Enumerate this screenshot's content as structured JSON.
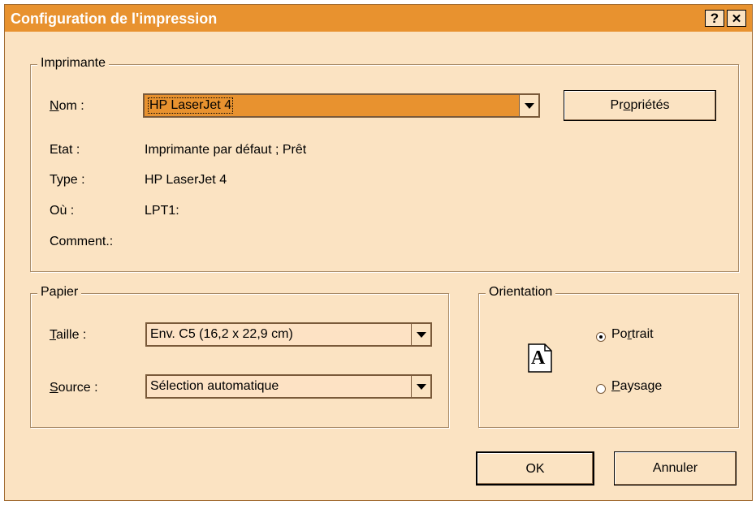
{
  "dialog": {
    "title": "Configuration de l'impression",
    "help_label": "?",
    "close_label": "✕"
  },
  "printer": {
    "legend": "Imprimante",
    "name_label_u": "N",
    "name_label_rest": "om :",
    "name_value": "HP LaserJet 4",
    "properties_pre": "Pr",
    "properties_u": "o",
    "properties_post": "priétés",
    "state_label": "Etat :",
    "state_value": "Imprimante par défaut ; Prêt",
    "type_label": "Type :",
    "type_value": "HP LaserJet 4",
    "where_label": "Où :",
    "where_value": "LPT1:",
    "comment_label": "Comment.:"
  },
  "paper": {
    "legend": "Papier",
    "size_label_u": "T",
    "size_label_rest": "aille :",
    "size_value": "Env. C5 (16,2 x 22,9 cm)",
    "source_label_u": "S",
    "source_label_rest": "ource :",
    "source_value": "Sélection automatique"
  },
  "orientation": {
    "legend": "Orientation",
    "icon_letter": "A",
    "portrait_pre": "Po",
    "portrait_u": "r",
    "portrait_post": "trait",
    "landscape_u": "P",
    "landscape_post": "aysage",
    "selected": "portrait"
  },
  "footer": {
    "ok_label": "OK",
    "cancel_label": "Annuler"
  }
}
